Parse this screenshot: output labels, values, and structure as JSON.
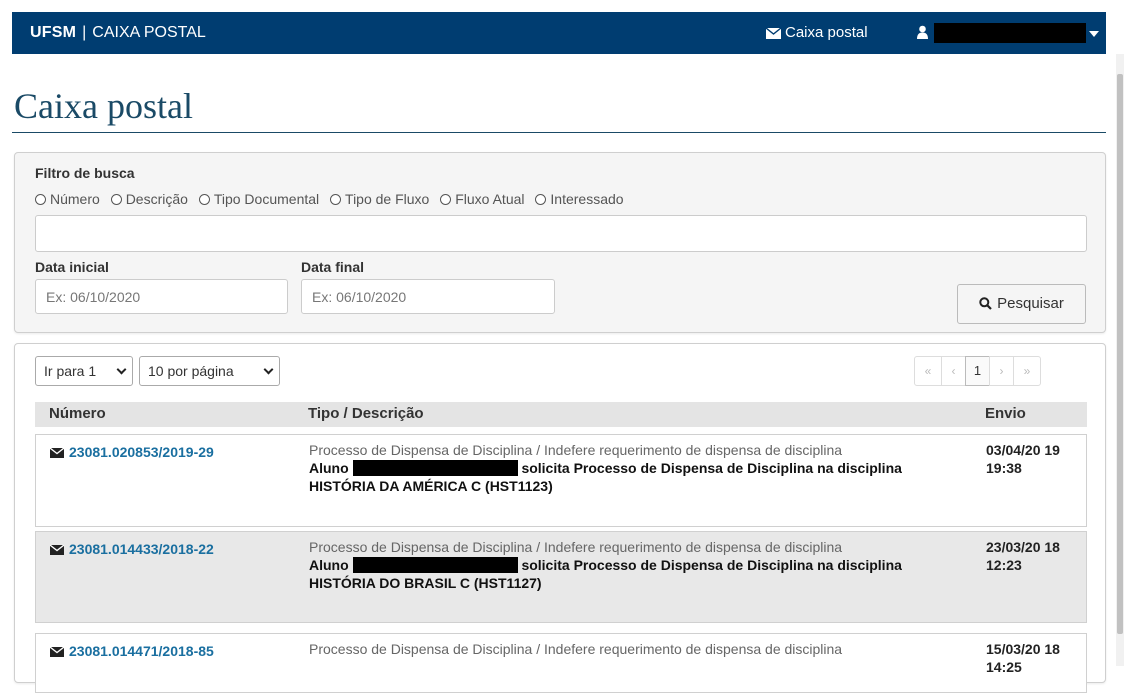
{
  "navbar": {
    "brand_bold": "UFSM",
    "brand_sep": "|",
    "brand_name": "CAIXA POSTAL",
    "inbox_link": "Caixa postal"
  },
  "page": {
    "title": "Caixa postal"
  },
  "filter": {
    "label": "Filtro de busca",
    "radios": [
      "Número",
      "Descrição",
      "Tipo Documental",
      "Tipo de Fluxo",
      "Fluxo Atual",
      "Interessado"
    ],
    "search_value": "",
    "start_date_label": "Data inicial",
    "start_date_placeholder": "Ex: 06/10/2020",
    "end_date_label": "Data final",
    "end_date_placeholder": "Ex: 06/10/2020",
    "search_button": "Pesquisar"
  },
  "list": {
    "goto_select": "Ir para 1",
    "per_page_select": "10 por página",
    "pager": {
      "first": "«",
      "prev": "‹",
      "current": "1",
      "next": "›",
      "last": "»"
    },
    "columns": {
      "number": "Número",
      "type_desc": "Tipo / Descrição",
      "sent": "Envio"
    },
    "rows": [
      {
        "number": "23081.020853/2019-29",
        "type_desc": "Processo de Dispensa de Disciplina / Indefere requerimento de dispensa de disciplina",
        "detail_prefix": "Aluno",
        "detail_suffix": "solicita Processo de Dispensa de Disciplina na disciplina HISTÓRIA DA AMÉRICA C (HST1123)",
        "sent": "03/04/20 19 19:38"
      },
      {
        "number": "23081.014433/2018-22",
        "type_desc": "Processo de Dispensa de Disciplina / Indefere requerimento de dispensa de disciplina",
        "detail_prefix": "Aluno",
        "detail_suffix": "solicita Processo de Dispensa de Disciplina na disciplina HISTÓRIA DO BRASIL C (HST1127)",
        "sent": "23/03/20 18 12:23"
      },
      {
        "number": "23081.014471/2018-85",
        "type_desc": "Processo de Dispensa de Disciplina / Indefere requerimento de dispensa de disciplina",
        "sent": "15/03/20 18 14:25"
      }
    ]
  },
  "colors": {
    "navbar_bg": "#003d71",
    "title_color": "#1a4a66",
    "link_color": "#1a6fa0"
  }
}
